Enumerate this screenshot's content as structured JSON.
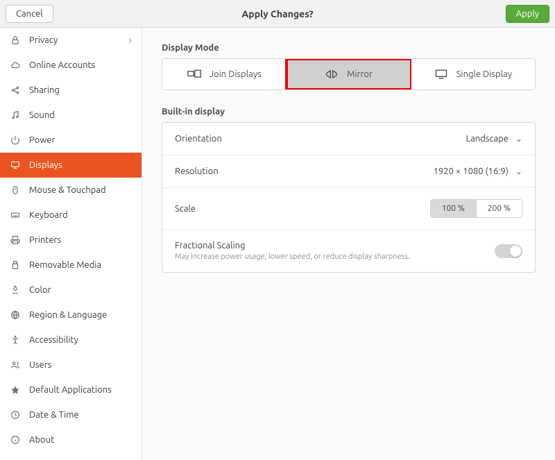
{
  "header": {
    "cancel": "Cancel",
    "title": "Apply Changes?",
    "apply": "Apply"
  },
  "sidebar": {
    "items": [
      {
        "label": "Privacy",
        "icon": "lock",
        "hasChevron": true
      },
      {
        "label": "Online Accounts",
        "icon": "cloud"
      },
      {
        "label": "Sharing",
        "icon": "share"
      },
      {
        "label": "Sound",
        "icon": "music"
      },
      {
        "label": "Power",
        "icon": "power"
      },
      {
        "label": "Displays",
        "icon": "display",
        "active": true
      },
      {
        "label": "Mouse & Touchpad",
        "icon": "mouse"
      },
      {
        "label": "Keyboard",
        "icon": "keyboard"
      },
      {
        "label": "Printers",
        "icon": "printer"
      },
      {
        "label": "Removable Media",
        "icon": "usb"
      },
      {
        "label": "Color",
        "icon": "color"
      },
      {
        "label": "Region & Language",
        "icon": "globe"
      },
      {
        "label": "Accessibility",
        "icon": "accessibility"
      },
      {
        "label": "Users",
        "icon": "users"
      },
      {
        "label": "Default Applications",
        "icon": "star"
      },
      {
        "label": "Date & Time",
        "icon": "clock"
      },
      {
        "label": "About",
        "icon": "info"
      }
    ]
  },
  "display_mode": {
    "title": "Display Mode",
    "options": {
      "join": "Join Displays",
      "mirror": "Mirror",
      "single": "Single Display"
    },
    "selected": "mirror"
  },
  "builtin": {
    "title": "Built-in display",
    "orientation_label": "Orientation",
    "orientation_value": "Landscape",
    "resolution_label": "Resolution",
    "resolution_value": "1920 × 1080 (16:9)",
    "scale_label": "Scale",
    "scale_options": {
      "a": "100 %",
      "b": "200 %"
    },
    "scale_active": "a",
    "fractional_label": "Fractional Scaling",
    "fractional_sub": "May increase power usage, lower speed, or reduce display sharpness.",
    "fractional_on": false
  }
}
